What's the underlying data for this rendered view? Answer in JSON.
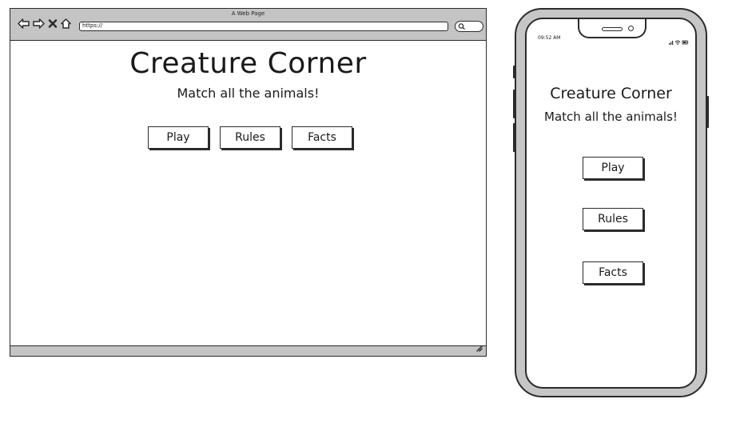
{
  "browser": {
    "window_title": "A Web Page",
    "url": "https://",
    "page": {
      "title": "Creature Corner",
      "subtitle": "Match all the animals!",
      "buttons": {
        "play": "Play",
        "rules": "Rules",
        "facts": "Facts"
      }
    }
  },
  "phone": {
    "status_time": "09:52 AM",
    "page": {
      "title": "Creature Corner",
      "subtitle": "Match all the animals!",
      "buttons": {
        "play": "Play",
        "rules": "Rules",
        "facts": "Facts"
      }
    }
  },
  "colors": {
    "chrome_gray": "#c4c4c4",
    "outline": "#2b2b2b",
    "background": "#ffffff"
  },
  "icons": [
    "back-arrow-icon",
    "forward-arrow-icon",
    "close-icon",
    "home-icon",
    "search-icon",
    "resize-grip-icon",
    "signal-icon",
    "wifi-icon",
    "battery-icon"
  ]
}
